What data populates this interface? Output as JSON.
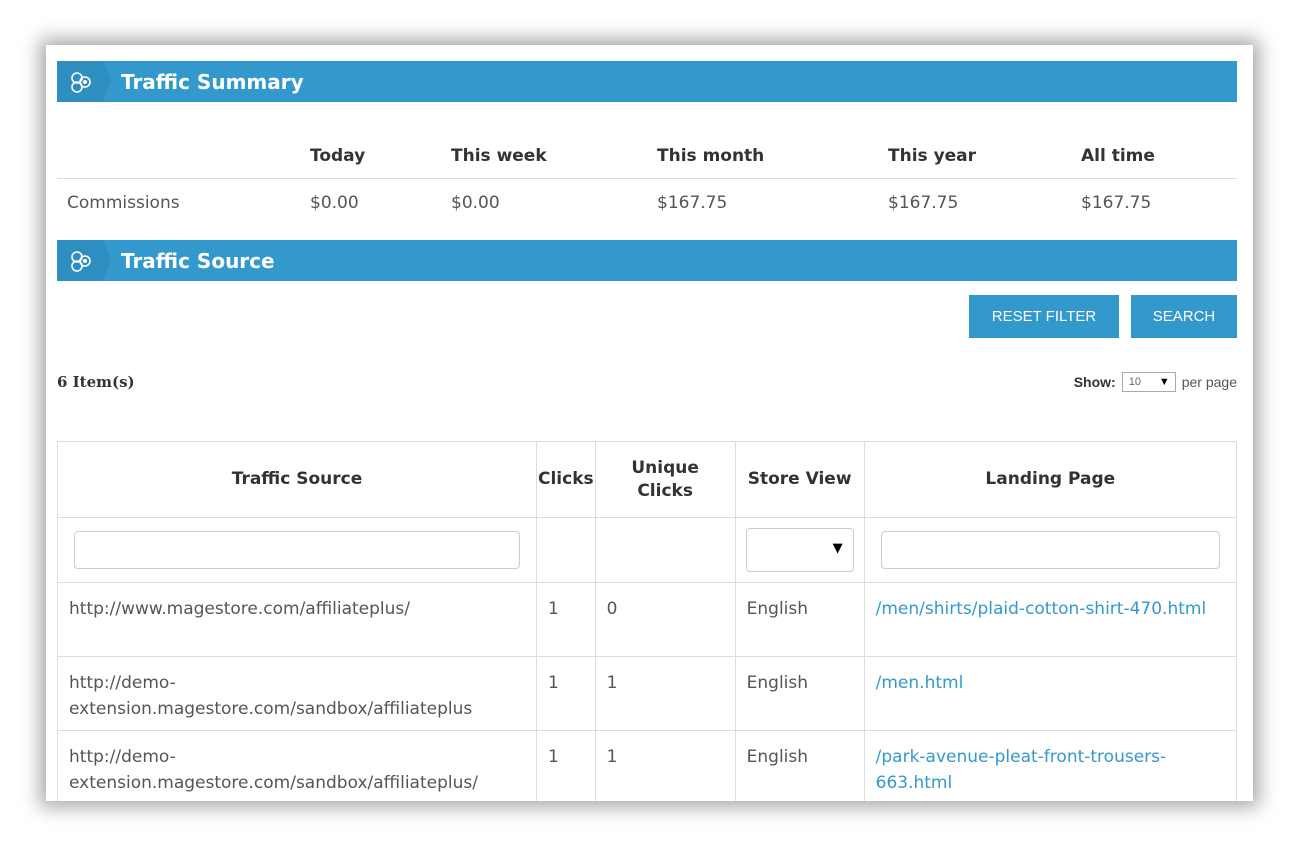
{
  "summary": {
    "title": "Traffic Summary",
    "columns": [
      "",
      "Today",
      "This week",
      "This month",
      "This year",
      "All time"
    ],
    "rows": [
      {
        "label": "Commissions",
        "today": "$0.00",
        "week": "$0.00",
        "month": "$167.75",
        "year": "$167.75",
        "all": "$167.75"
      }
    ]
  },
  "source": {
    "title": "Traffic Source",
    "reset_label": "RESET FILTER",
    "search_label": "SEARCH",
    "items_count": "6 Item(s)",
    "show_label": "Show:",
    "per_page_value": "10",
    "per_page_suffix": "per page",
    "columns": {
      "traffic_source": "Traffic Source",
      "clicks": "Clicks",
      "unique_clicks": "Unique Clicks",
      "store_view": "Store View",
      "landing_page": "Landing Page"
    },
    "rows": [
      {
        "source": "http://www.magestore.com/affiliateplus/",
        "clicks": "1",
        "unique": "0",
        "store": "English",
        "landing": "/men/shirts/plaid-cotton-shirt-470.html"
      },
      {
        "source": "http://demo-extension.magestore.com/sandbox/affiliateplus",
        "clicks": "1",
        "unique": "1",
        "store": "English",
        "landing": "/men.html"
      },
      {
        "source": "http://demo-extension.magestore.com/sandbox/affiliateplus/",
        "clicks": "1",
        "unique": "1",
        "store": "English",
        "landing": "/park-avenue-pleat-front-trousers-663.html"
      }
    ]
  },
  "colors": {
    "accent": "#3399cc",
    "link": "#3399cc"
  },
  "icons": {
    "section": "hexagon-nodes-icon",
    "dropdown": "triangle-down-icon"
  }
}
